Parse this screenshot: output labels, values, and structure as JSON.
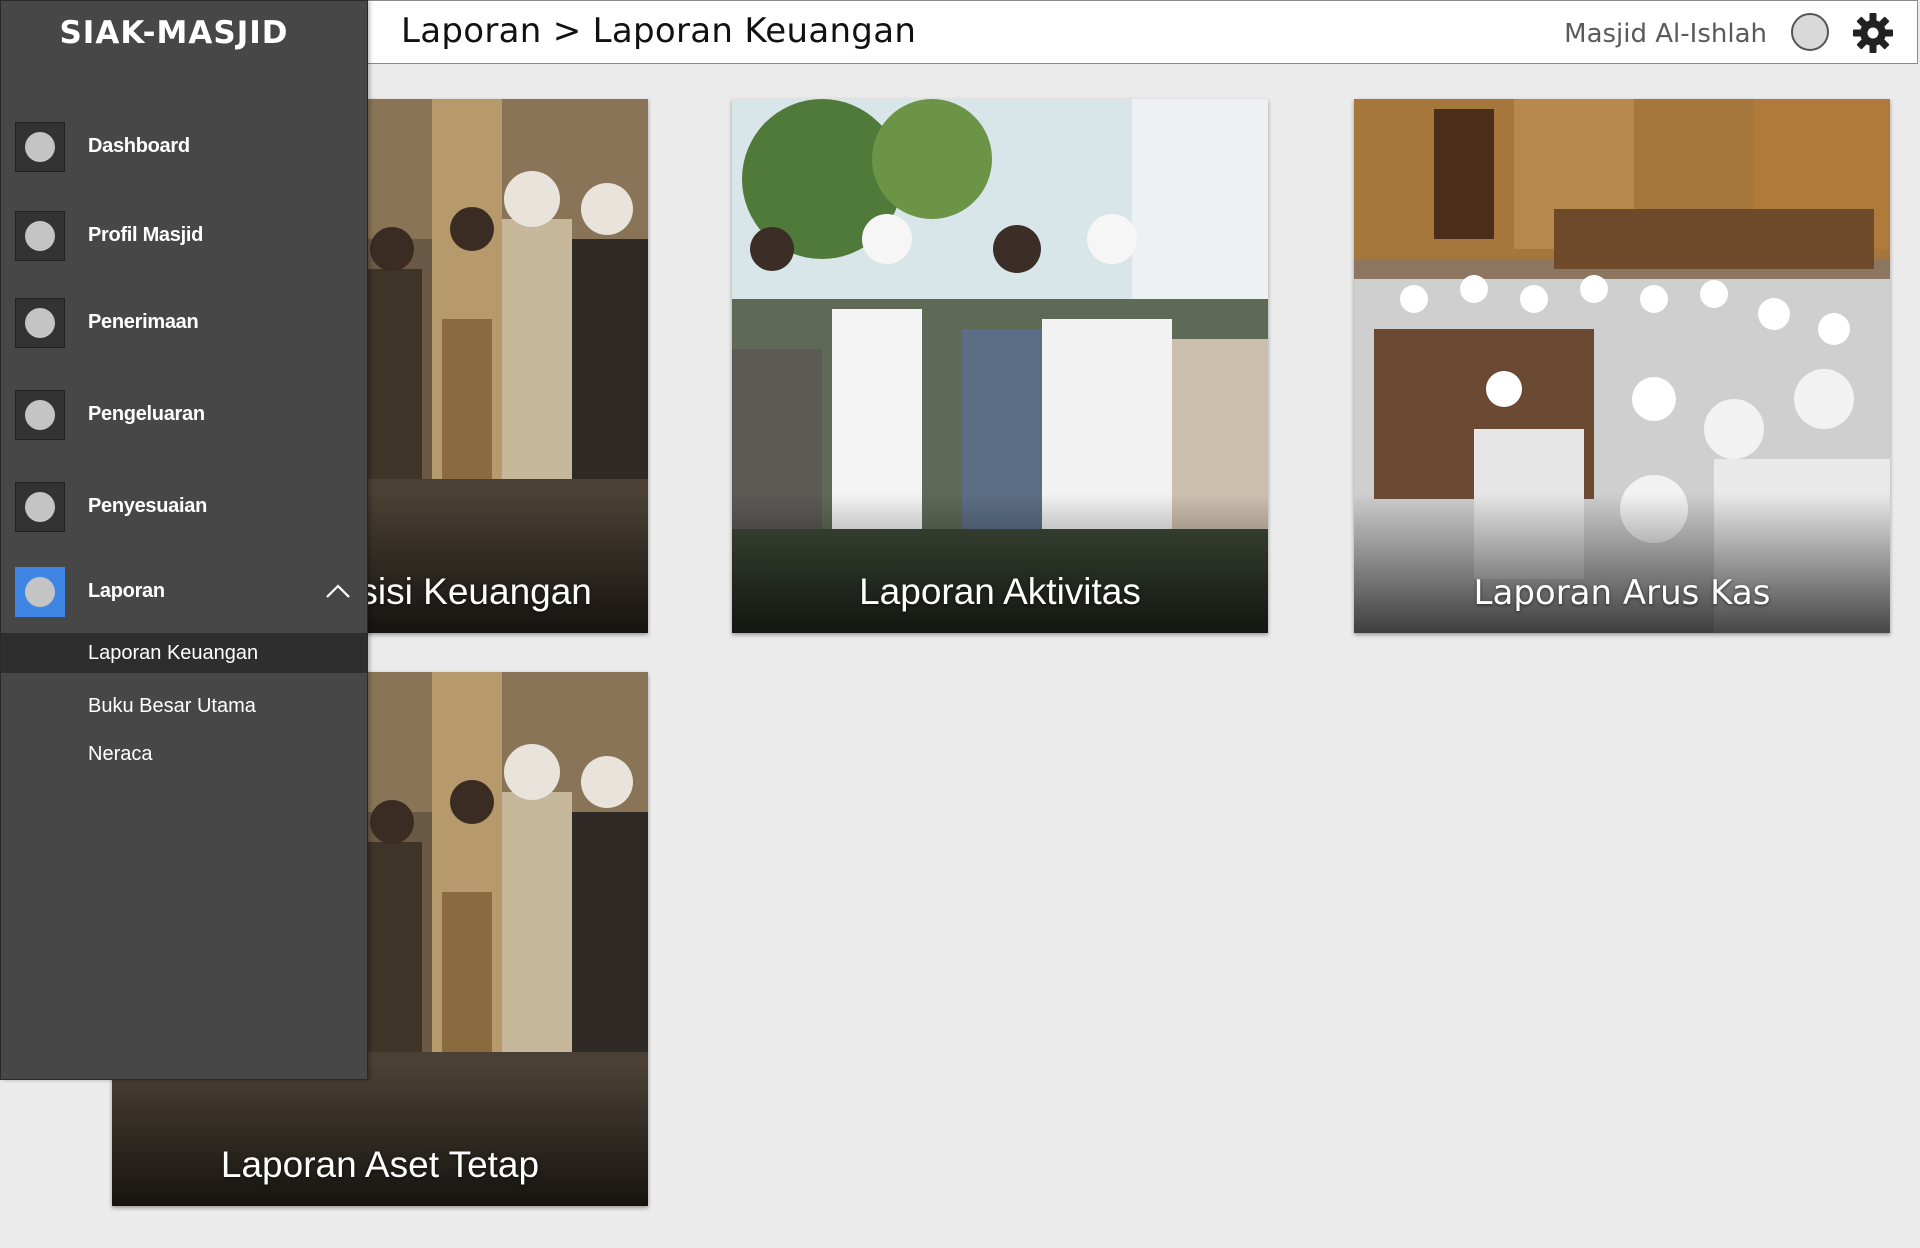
{
  "header": {
    "breadcrumb": "Laporan > Laporan Keuangan",
    "org_name": "Masjid Al-Ishlah"
  },
  "sidebar": {
    "brand": "SIAK-MASJID",
    "items": [
      {
        "label": "Dashboard"
      },
      {
        "label": "Profil Masjid"
      },
      {
        "label": "Penerimaan"
      },
      {
        "label": "Pengeluaran"
      },
      {
        "label": "Penyesuaian"
      },
      {
        "label": "Laporan",
        "expanded": true,
        "active": true
      }
    ],
    "subitems": [
      {
        "label": "Laporan Keuangan",
        "active": true
      },
      {
        "label": "Buku Besar Utama"
      },
      {
        "label": "Neraca"
      }
    ]
  },
  "cards": [
    {
      "title": "Laporan Posisi Keuangan"
    },
    {
      "title": "Laporan Aktivitas"
    },
    {
      "title": "Laporan Arus Kas"
    },
    {
      "title": "Laporan Aset Tetap"
    }
  ],
  "colors": {
    "sidebar_bg": "#474747",
    "active_accent": "#3f86e4",
    "page_bg": "#ebebeb"
  }
}
